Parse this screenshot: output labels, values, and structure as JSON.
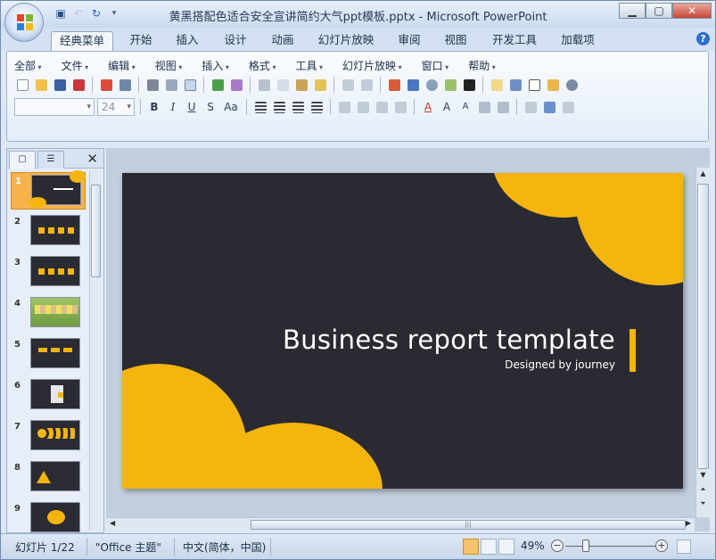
{
  "window": {
    "title": "黄黑搭配色适合安全宣讲简约大气ppt模板.pptx - Microsoft PowerPoint"
  },
  "tabs": [
    {
      "label": "经典菜单",
      "active": true
    },
    {
      "label": "开始"
    },
    {
      "label": "插入"
    },
    {
      "label": "设计"
    },
    {
      "label": "动画"
    },
    {
      "label": "幻灯片放映"
    },
    {
      "label": "审阅"
    },
    {
      "label": "视图"
    },
    {
      "label": "开发工具"
    },
    {
      "label": "加载项"
    }
  ],
  "menus": [
    "全部",
    "文件",
    "编辑",
    "视图",
    "插入",
    "格式",
    "工具",
    "幻灯片放映",
    "窗口",
    "帮助"
  ],
  "font": {
    "size": "24"
  },
  "slides": [
    "1",
    "2",
    "3",
    "4",
    "5",
    "6",
    "7",
    "8",
    "9"
  ],
  "slide": {
    "title": "Business report template",
    "subtitle": "Designed by journey"
  },
  "status": {
    "slide": "幻灯片 1/22",
    "theme": "\"Office 主题\"",
    "language": "中文(简体，中国)",
    "zoom": "49%"
  },
  "colors": {
    "accent": "#f4b50f",
    "slide_bg": "#2a2a33"
  }
}
